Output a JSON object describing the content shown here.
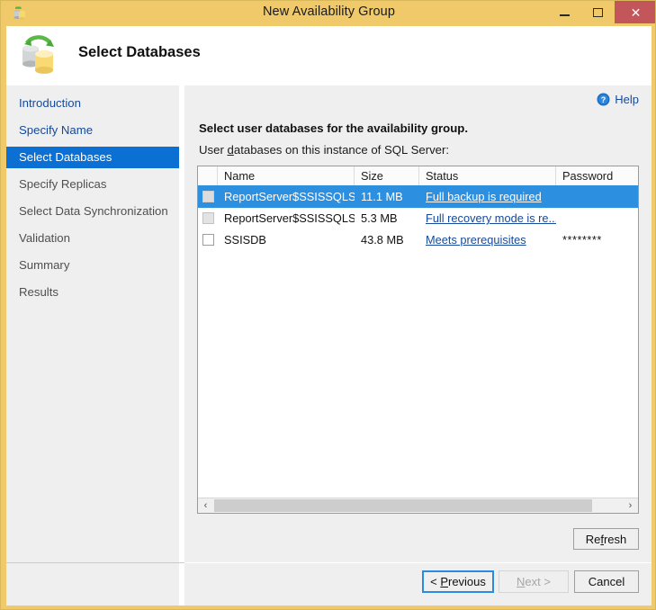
{
  "window": {
    "title": "New Availability Group",
    "icon": "database-sync-icon",
    "controls": {
      "minimize": "minimize-icon",
      "maximize": "maximize-icon",
      "close": "✕"
    }
  },
  "header": {
    "icon": "databases-sync-icon",
    "title": "Select Databases"
  },
  "sidebar": {
    "items": [
      {
        "label": "Introduction",
        "state": "link"
      },
      {
        "label": "Specify Name",
        "state": "link"
      },
      {
        "label": "Select Databases",
        "state": "current"
      },
      {
        "label": "Specify Replicas",
        "state": "inactive"
      },
      {
        "label": "Select Data Synchronization",
        "state": "inactive"
      },
      {
        "label": "Validation",
        "state": "inactive"
      },
      {
        "label": "Summary",
        "state": "inactive"
      },
      {
        "label": "Results",
        "state": "inactive"
      }
    ]
  },
  "content": {
    "help_label": "Help",
    "help_icon": "help-circle-icon",
    "prompt": "Select user databases for the availability group.",
    "sublabel_before": "User ",
    "sublabel_accel": "d",
    "sublabel_after": "atabases on this instance of SQL Server:",
    "columns": [
      "Name",
      "Size",
      "Status",
      "Password"
    ],
    "rows": [
      {
        "name": "ReportServer$SSISSQLSER...",
        "size": "11.1 MB",
        "status": "Full backup is required",
        "password": "",
        "checked": false,
        "checkbox_disabled": true,
        "selected": true
      },
      {
        "name": "ReportServer$SSISSQLSER...",
        "size": "5.3 MB",
        "status": "Full recovery mode is re...",
        "password": "",
        "checked": false,
        "checkbox_disabled": true,
        "selected": false
      },
      {
        "name": "SSISDB",
        "size": "43.8 MB",
        "status": "Meets prerequisites",
        "password": "********",
        "checked": false,
        "checkbox_disabled": false,
        "selected": false
      }
    ],
    "scrollbar": {
      "left_arrow": "‹",
      "right_arrow": "›"
    },
    "refresh": {
      "before": "Re",
      "accel": "f",
      "after": "resh"
    }
  },
  "footer": {
    "previous": {
      "before": "< ",
      "accel": "P",
      "after": "revious"
    },
    "next": {
      "before": "",
      "accel": "N",
      "after": "ext >"
    },
    "cancel": {
      "before": "Cancel",
      "accel": "",
      "after": ""
    }
  },
  "colors": {
    "title_bar": "#efc96a",
    "close_button": "#c2565a",
    "selection": "#2d8fe0",
    "sidebar_current": "#0b6fd3",
    "link": "#16499a",
    "body": "#efefef"
  }
}
